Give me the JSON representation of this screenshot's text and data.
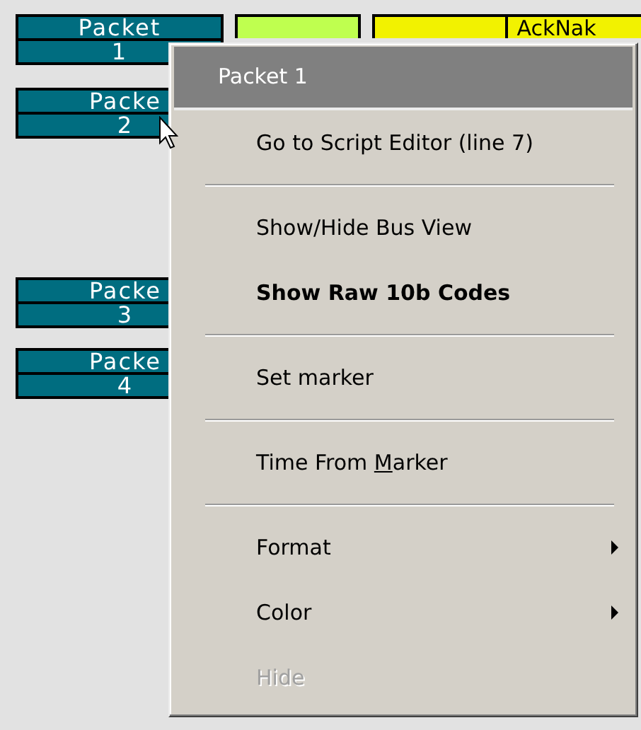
{
  "packets": [
    {
      "label": "Packet",
      "number": "1"
    },
    {
      "label": "Packe",
      "number": "2"
    },
    {
      "label": "Packe",
      "number": "3"
    },
    {
      "label": "Packe",
      "number": "4"
    }
  ],
  "top_cells": [
    {
      "kind": "plain",
      "color": "#bfff4f"
    },
    {
      "kind": "split",
      "color": "#f2f200",
      "text": "AckNak"
    }
  ],
  "context_menu": {
    "title": "Packet 1",
    "entries": [
      {
        "kind": "item",
        "label": "Go to Script Editor (line 7)",
        "default": false,
        "disabled": false,
        "submenu": false
      },
      {
        "kind": "separator"
      },
      {
        "kind": "item",
        "label": "Show/Hide Bus View",
        "default": false,
        "disabled": false,
        "submenu": false
      },
      {
        "kind": "item",
        "label": "Show Raw 10b Codes",
        "default": true,
        "disabled": false,
        "submenu": false
      },
      {
        "kind": "separator"
      },
      {
        "kind": "item",
        "label": "Set marker",
        "default": false,
        "disabled": false,
        "submenu": false
      },
      {
        "kind": "separator"
      },
      {
        "kind": "mnemonic_item",
        "label_before": "Time From ",
        "mnemonic": "M",
        "label_after": "arker",
        "default": false,
        "disabled": false,
        "submenu": false
      },
      {
        "kind": "separator"
      },
      {
        "kind": "item",
        "label": "Format",
        "default": false,
        "disabled": false,
        "submenu": true
      },
      {
        "kind": "item",
        "label": "Color",
        "default": false,
        "disabled": false,
        "submenu": true
      },
      {
        "kind": "item",
        "label": "Hide",
        "default": false,
        "disabled": true,
        "submenu": false
      }
    ]
  }
}
